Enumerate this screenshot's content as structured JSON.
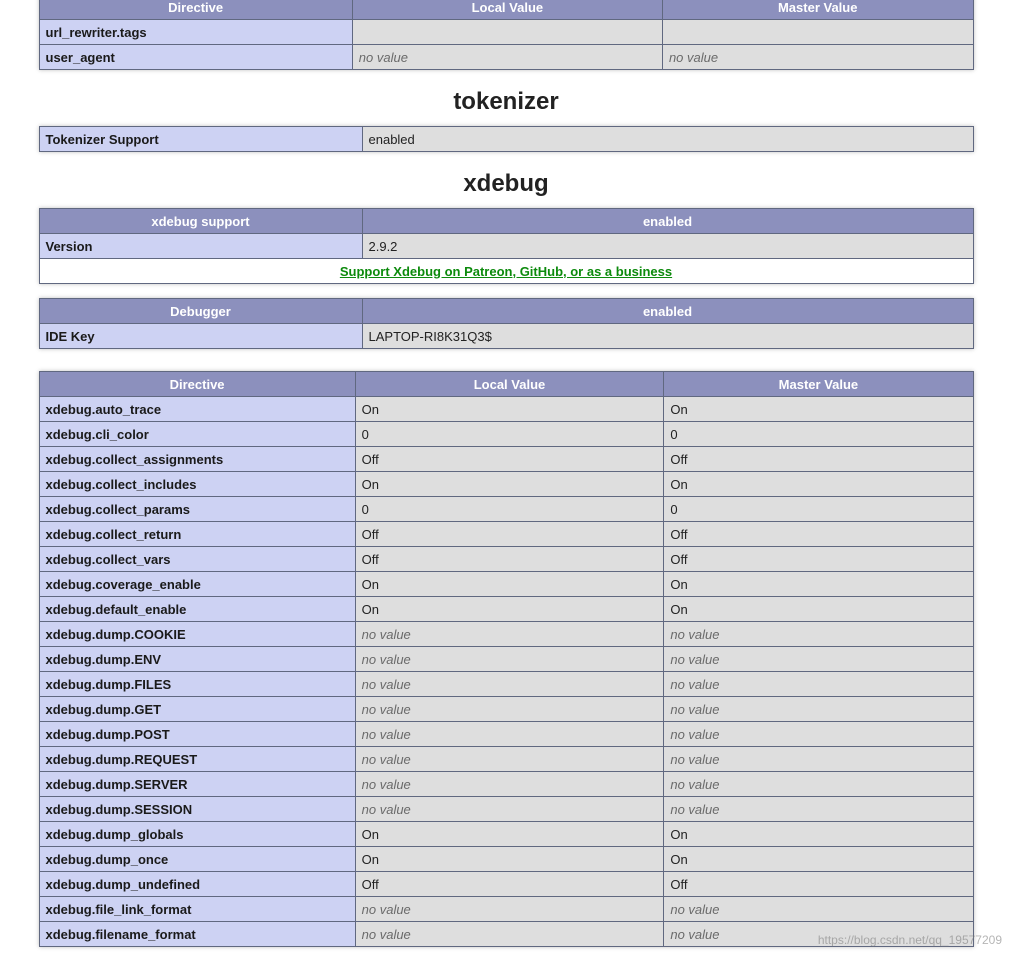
{
  "toprows": {
    "headers": [
      "Directive",
      "Local Value",
      "Master Value"
    ],
    "rows": [
      {
        "name": "url_rewriter.tags",
        "local": "",
        "master": "",
        "local_nv": false,
        "master_nv": false
      },
      {
        "name": "user_agent",
        "local": "no value",
        "master": "no value",
        "local_nv": true,
        "master_nv": true
      }
    ]
  },
  "sections": {
    "tokenizer": {
      "title": "tokenizer",
      "rows": [
        {
          "key": "Tokenizer Support",
          "val": "enabled"
        }
      ]
    },
    "xdebug": {
      "title": "xdebug",
      "support": {
        "header_left": "xdebug support",
        "header_right": "enabled",
        "rows": [
          {
            "key": "Version",
            "val": "2.9.2"
          }
        ],
        "support_link": "Support Xdebug on Patreon, GitHub, or as a business"
      },
      "debugger": {
        "header_left": "Debugger",
        "header_right": "enabled",
        "rows": [
          {
            "key": "IDE Key",
            "val": "LAPTOP-RI8K31Q3$"
          }
        ]
      },
      "directives": {
        "headers": [
          "Directive",
          "Local Value",
          "Master Value"
        ],
        "rows": [
          {
            "name": "xdebug.auto_trace",
            "local": "On",
            "master": "On"
          },
          {
            "name": "xdebug.cli_color",
            "local": "0",
            "master": "0"
          },
          {
            "name": "xdebug.collect_assignments",
            "local": "Off",
            "master": "Off"
          },
          {
            "name": "xdebug.collect_includes",
            "local": "On",
            "master": "On"
          },
          {
            "name": "xdebug.collect_params",
            "local": "0",
            "master": "0"
          },
          {
            "name": "xdebug.collect_return",
            "local": "Off",
            "master": "Off"
          },
          {
            "name": "xdebug.collect_vars",
            "local": "Off",
            "master": "Off"
          },
          {
            "name": "xdebug.coverage_enable",
            "local": "On",
            "master": "On"
          },
          {
            "name": "xdebug.default_enable",
            "local": "On",
            "master": "On"
          },
          {
            "name": "xdebug.dump.COOKIE",
            "local": "no value",
            "master": "no value",
            "nv": true
          },
          {
            "name": "xdebug.dump.ENV",
            "local": "no value",
            "master": "no value",
            "nv": true
          },
          {
            "name": "xdebug.dump.FILES",
            "local": "no value",
            "master": "no value",
            "nv": true
          },
          {
            "name": "xdebug.dump.GET",
            "local": "no value",
            "master": "no value",
            "nv": true
          },
          {
            "name": "xdebug.dump.POST",
            "local": "no value",
            "master": "no value",
            "nv": true
          },
          {
            "name": "xdebug.dump.REQUEST",
            "local": "no value",
            "master": "no value",
            "nv": true
          },
          {
            "name": "xdebug.dump.SERVER",
            "local": "no value",
            "master": "no value",
            "nv": true
          },
          {
            "name": "xdebug.dump.SESSION",
            "local": "no value",
            "master": "no value",
            "nv": true
          },
          {
            "name": "xdebug.dump_globals",
            "local": "On",
            "master": "On"
          },
          {
            "name": "xdebug.dump_once",
            "local": "On",
            "master": "On"
          },
          {
            "name": "xdebug.dump_undefined",
            "local": "Off",
            "master": "Off"
          },
          {
            "name": "xdebug.file_link_format",
            "local": "no value",
            "master": "no value",
            "nv": true
          },
          {
            "name": "xdebug.filename_format",
            "local": "no value",
            "master": "no value",
            "nv": true
          }
        ]
      }
    }
  },
  "watermark": "https://blog.csdn.net/qq_19577209"
}
